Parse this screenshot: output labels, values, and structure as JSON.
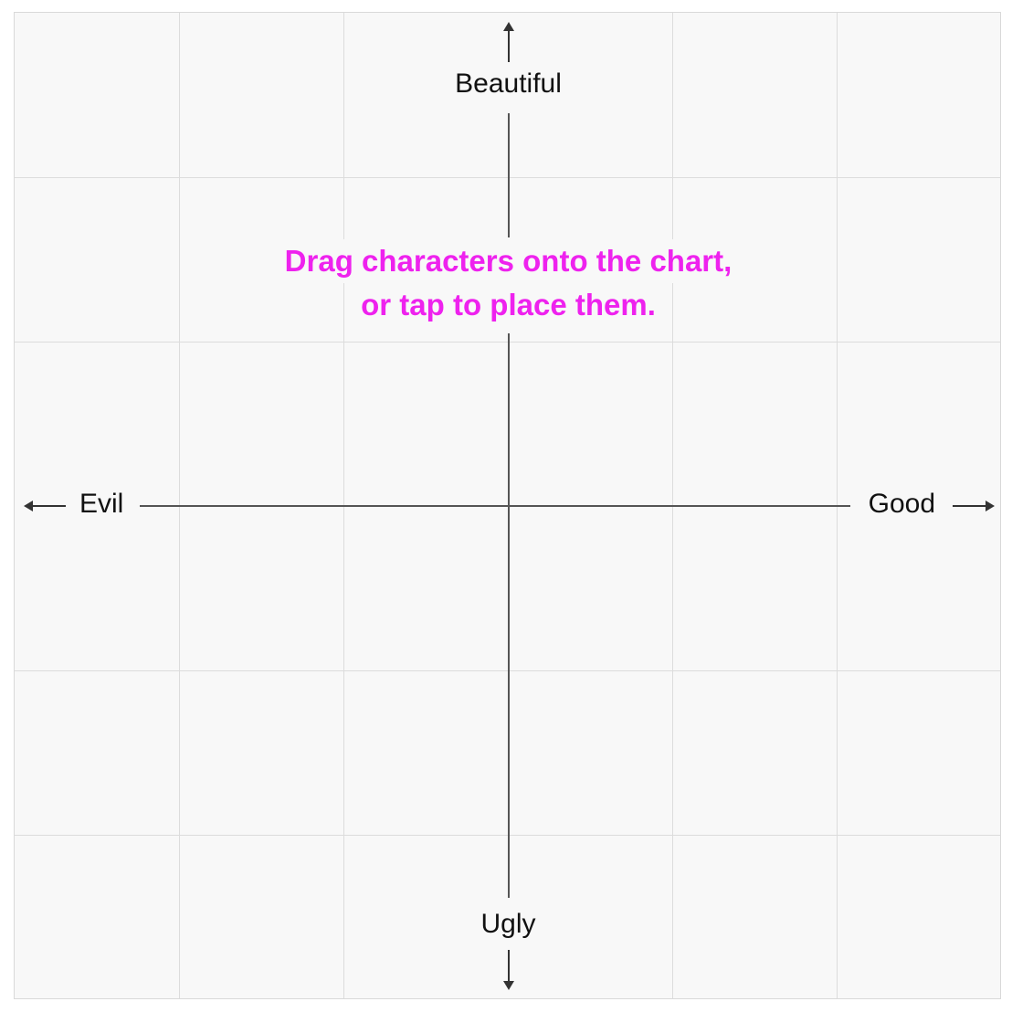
{
  "chart": {
    "instruction_line1": "Drag characters onto the chart,",
    "instruction_line2": "or tap to place them.",
    "instruction_color": "#ee22ee",
    "axis_top_label": "Beautiful",
    "axis_bottom_label": "Ugly",
    "axis_left_label": "Evil",
    "axis_right_label": "Good",
    "grid_color": "#dcdcdc",
    "axis_color": "#555555",
    "background_color": "#f8f8f8"
  },
  "icons": {
    "top": "arrow-up-icon",
    "bottom": "arrow-down-icon",
    "left": "arrow-left-icon",
    "right": "arrow-right-icon"
  }
}
